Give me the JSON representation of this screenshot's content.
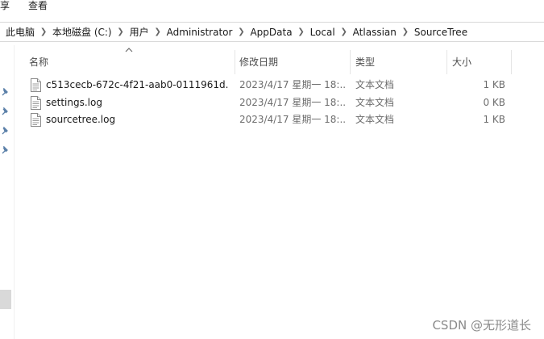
{
  "ribbon": {
    "tab_fragment": "享",
    "view_tab": "查看"
  },
  "breadcrumb": [
    "此电脑",
    "本地磁盘 (C:)",
    "用户",
    "Administrator",
    "AppData",
    "Local",
    "Atlassian",
    "SourceTree"
  ],
  "columns": {
    "name": "名称",
    "modified": "修改日期",
    "type": "类型",
    "size": "大小"
  },
  "files": [
    {
      "name": "c513cecb-672c-4f21-aab0-0111961d...",
      "modified": "2023/4/17 星期一 18:...",
      "type": "文本文档",
      "size": "1 KB",
      "icon": "text-file-icon"
    },
    {
      "name": "settings.log",
      "modified": "2023/4/17 星期一 18:...",
      "type": "文本文档",
      "size": "0 KB",
      "icon": "text-file-icon"
    },
    {
      "name": "sourcetree.log",
      "modified": "2023/4/17 星期一 18:...",
      "type": "文本文档",
      "size": "1 KB",
      "icon": "text-file-icon"
    }
  ],
  "quick_access_pins": [
    "pin-icon",
    "pin-icon",
    "pin-icon",
    "pin-icon"
  ],
  "watermark": "CSDN @无形道长",
  "colors": {
    "text": "#1a1a1a",
    "muted": "#6d6d6d",
    "header_text": "#4c4c4c",
    "border": "#d9d9d9"
  }
}
